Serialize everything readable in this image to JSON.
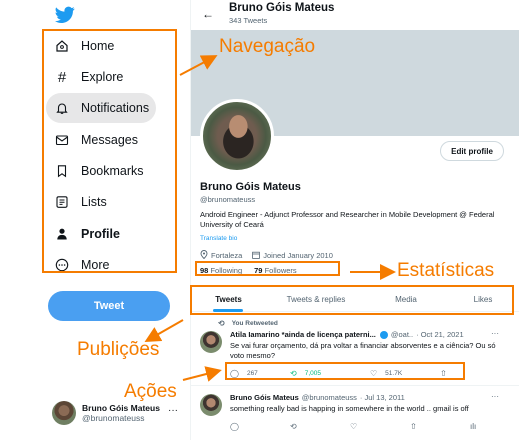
{
  "sidebar": {
    "logo_icon": "twitter-bird-icon",
    "items": [
      {
        "label": "Home",
        "icon": "home-icon"
      },
      {
        "label": "Explore",
        "icon": "hashtag-icon"
      },
      {
        "label": "Notifications",
        "icon": "bell-icon"
      },
      {
        "label": "Messages",
        "icon": "envelope-icon"
      },
      {
        "label": "Bookmarks",
        "icon": "bookmark-icon"
      },
      {
        "label": "Lists",
        "icon": "list-icon"
      },
      {
        "label": "Profile",
        "icon": "person-icon"
      },
      {
        "label": "More",
        "icon": "more-circle-icon"
      }
    ],
    "active_item": "Notifications",
    "tweet_button": "Tweet",
    "account": {
      "name": "Bruno Góis Mateus",
      "handle": "@brunomateuss",
      "menu": "···"
    }
  },
  "header": {
    "back": "←",
    "name": "Bruno Góis Mateus",
    "tweet_count": "343 Tweets"
  },
  "profile": {
    "edit_button": "Edit profile",
    "name": "Bruno Góis Mateus",
    "handle": "@brunomateuss",
    "bio": "Android Engineer  - Adjunct Professor  and Researcher in Mobile Development @ Federal University of Ceará",
    "translate": "Translate bio",
    "location": "Fortaleza",
    "joined": "Joined January 2010",
    "following_count": "98",
    "following_label": "Following",
    "followers_count": "79",
    "followers_label": "Followers"
  },
  "tabs": [
    "Tweets",
    "Tweets & replies",
    "Media",
    "Likes"
  ],
  "tweets": [
    {
      "retweet_label": "You Retweeted",
      "author": "Atila Iamarino *ainda de licença paterni...",
      "handle": "@oat..",
      "date": "· Oct 21, 2021",
      "menu": "···",
      "text": "Se vai furar orçamento, dá pra voltar a financiar absorventes e a ciência? Ou só voto mesmo?",
      "replies": "267",
      "retweets": "7,005",
      "likes": "51.7K"
    },
    {
      "author": "Bruno Góis Mateus",
      "handle": "@brunomateuss",
      "date": "· Jul 13, 2011",
      "menu": "···",
      "text": "something really bad is happing in somewhere in the world .. gmail is off"
    }
  ],
  "annotations": {
    "navegacao": "Navegação",
    "estatisticas": "Estatísticas",
    "publicoes": "Publições",
    "acoes": "Ações",
    "color": "#f57c00"
  },
  "colors": {
    "accent": "#1d9bf0",
    "tweet_button": "#4a9ff1",
    "banner": "#cfd9de",
    "retweet_green": "#00ba7c"
  }
}
